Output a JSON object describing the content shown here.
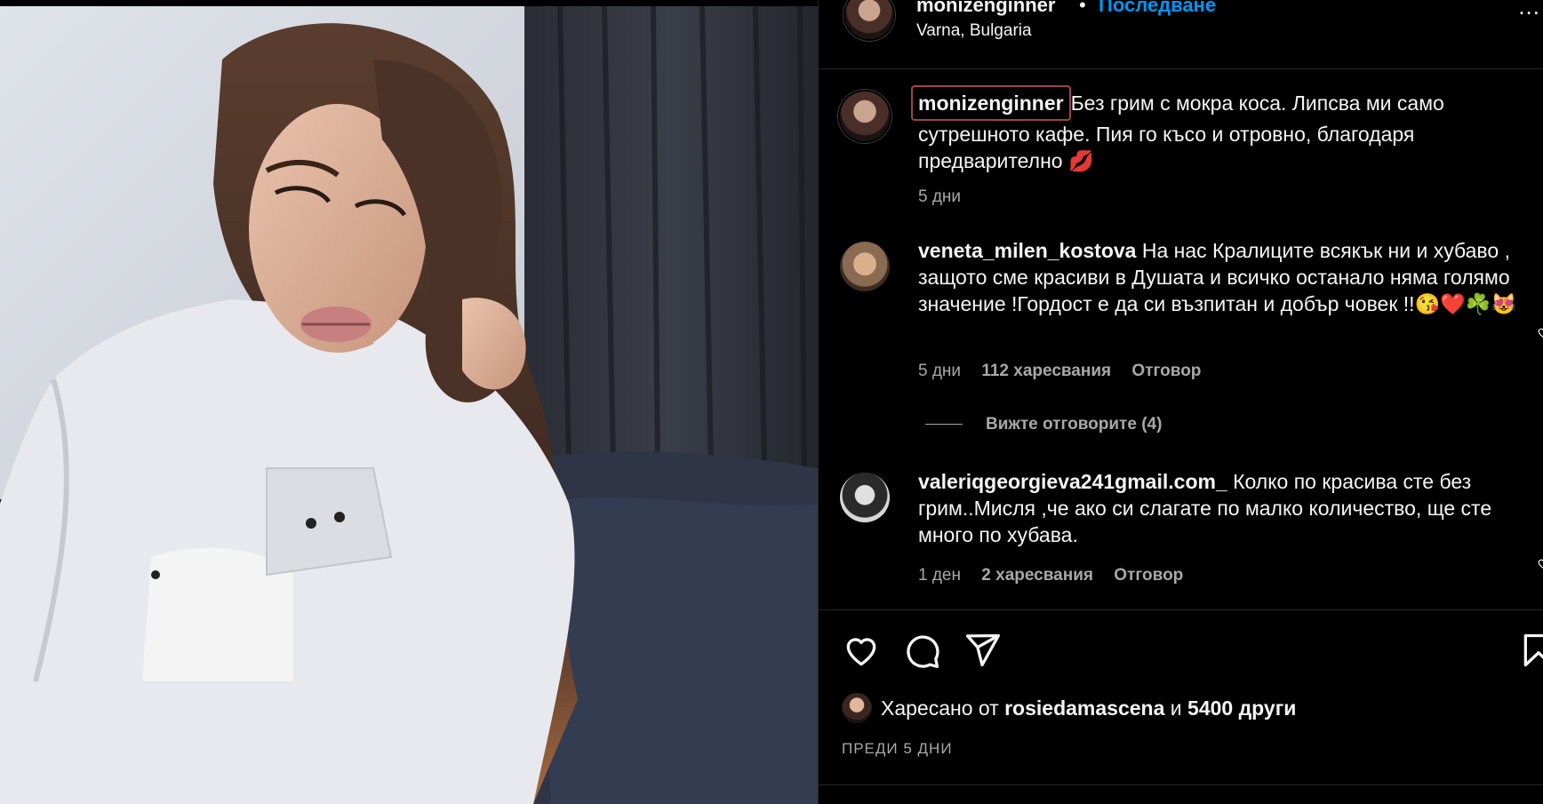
{
  "post": {
    "username": "monizenginner",
    "separator": "•",
    "follow_label": "Последване",
    "location": "Varna, Bulgaria",
    "more_label": "..."
  },
  "caption": {
    "username": "monizenginner",
    "text": "Без грим с мокра коса. Липсва ми само сутрешното кафе. Пия го късо и отровно, благодаря предварително 💋",
    "time": "5 дни"
  },
  "comments": [
    {
      "username": "veneta_milen_kostova",
      "text": "На нас Кралиците всякък ни и хубаво , защото сме красиви в Душата и всичко останало няма голямо значение !Гордост е да си възпитан и добър човек !!😘❤️☘️😻",
      "time": "5 дни",
      "likes": "112 харесвания",
      "reply": "Отговор",
      "view_replies": "Вижте отговорите (4)"
    },
    {
      "username": "valeriqgeorgieva241gmail.com_",
      "text": "Колко по красива сте без грим..Мисля ,че ако си слагате по малко количество, ще сте много по хубава.",
      "time": "1 ден",
      "likes": "2 харесвания",
      "reply": "Отговор"
    }
  ],
  "likes_line": {
    "prefix": "Харесано от",
    "user": "rosiedamascena",
    "conj": "и",
    "others": "5400 други"
  },
  "posted_ago": "ПРЕДИ 5 ДНИ",
  "colors": {
    "follow": "#0095f6",
    "owner_highlight": "#9b4450",
    "muted": "#a8a8a8"
  },
  "icons": [
    "heart-icon",
    "comment-icon",
    "share-icon",
    "bookmark-icon"
  ]
}
